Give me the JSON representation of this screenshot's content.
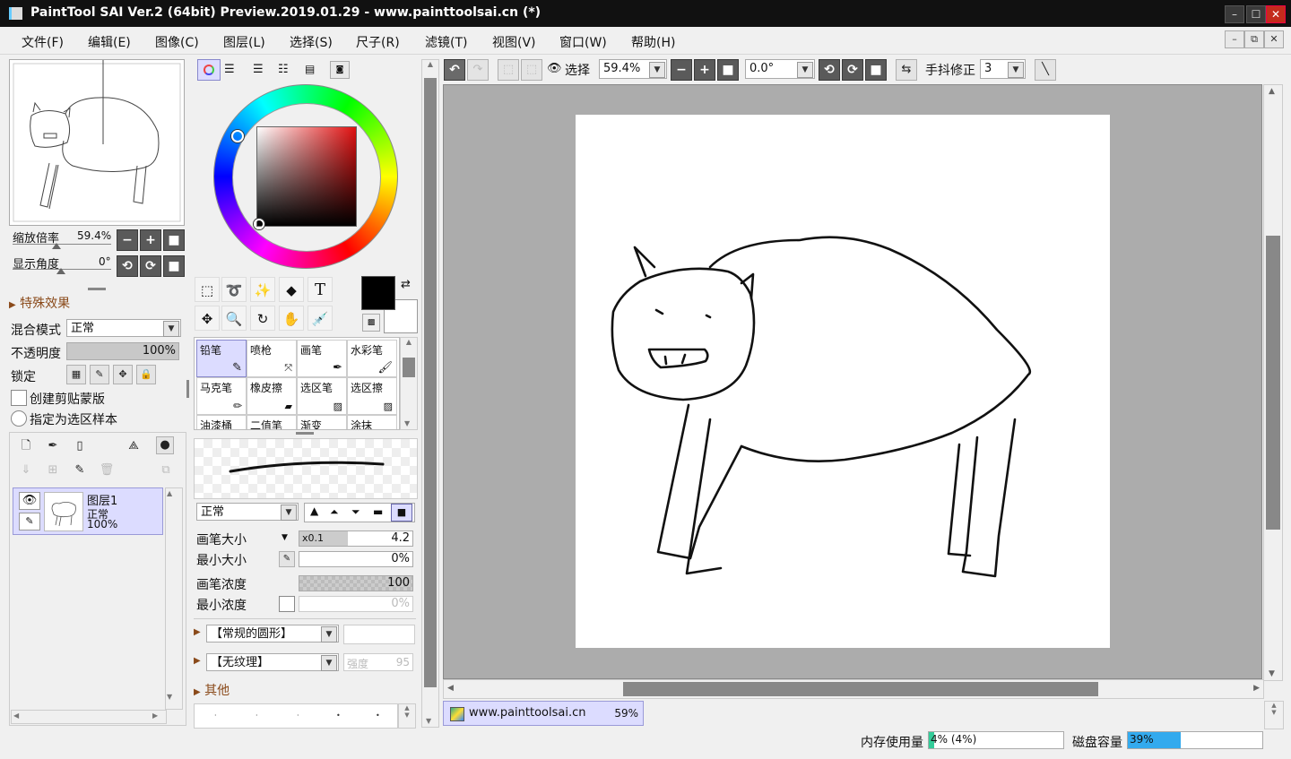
{
  "window": {
    "title": "PaintTool SAI Ver.2 (64bit) Preview.2019.01.29 - www.painttoolsai.cn (*)",
    "minimize": "–",
    "maximize": "☐",
    "close": "✕"
  },
  "menu": {
    "items": [
      "文件(F)",
      "编辑(E)",
      "图像(C)",
      "图层(L)",
      "选择(S)",
      "尺子(R)",
      "滤镜(T)",
      "视图(V)",
      "窗口(W)",
      "帮助(H)"
    ]
  },
  "navigator": {
    "zoom_label": "缩放倍率",
    "zoom_value": "59.4%",
    "angle_label": "显示角度",
    "angle_value": "0°"
  },
  "layer_props": {
    "effects_label": "特殊效果",
    "blend_label": "混合模式",
    "blend_value": "正常",
    "opacity_label": "不透明度",
    "opacity_value": "100%",
    "opacity": 1.0,
    "lock_label": "锁定",
    "clip_label": "创建剪贴蒙版",
    "sample_label": "指定为选区样本"
  },
  "layers": [
    {
      "name": "图层1",
      "mode": "正常",
      "opacity": "100%"
    }
  ],
  "tools": {
    "brushes": [
      {
        "name": "铅笔",
        "selected": true
      },
      {
        "name": "喷枪",
        "selected": false
      },
      {
        "name": "画笔",
        "selected": false
      },
      {
        "name": "水彩笔",
        "selected": false
      },
      {
        "name": "马克笔",
        "selected": false
      },
      {
        "name": "橡皮擦",
        "selected": false
      },
      {
        "name": "选区笔",
        "selected": false
      },
      {
        "name": "选区擦",
        "selected": false
      },
      {
        "name": "油漆桶",
        "selected": false
      },
      {
        "name": "二值笔",
        "selected": false
      },
      {
        "name": "渐变",
        "selected": false
      },
      {
        "name": "涂抹",
        "selected": false
      }
    ],
    "blend_value": "正常",
    "size_label": "画笔大小",
    "size_multiplier": "x0.1",
    "size_value": "4.2",
    "minsize_label": "最小大小",
    "minsize_value": "0%",
    "density_label": "画笔浓度",
    "density_value": "100",
    "mindensity_label": "最小浓度",
    "mindensity_value": "0%",
    "shape_value": "【常规的圆形】",
    "texture_value": "【无纹理】",
    "strength_label": "强度",
    "strength_value": "95",
    "other_label": "其他",
    "fg_color": "#000000",
    "bg_color": "#ffffff"
  },
  "toolbar": {
    "select_label": "选择",
    "zoom_value": "59.4%",
    "angle_value": "0.0°",
    "stabilizer_label": "手抖修正",
    "stabilizer_value": "3"
  },
  "document_tab": {
    "name": "www.painttoolsai.cn",
    "zoom": "59%"
  },
  "status": {
    "memory_label": "内存使用量",
    "memory_value": "4% (4%)",
    "memory_fraction": 0.04,
    "disk_label": "磁盘容量",
    "disk_value": "39%",
    "disk_fraction": 0.39
  },
  "colors": {
    "titlebar": "#111111",
    "accent_select": "#dcdcff",
    "canvas_bg": "#acacac",
    "memory_bar": "#33cc99",
    "disk_bar": "#33aaee"
  }
}
